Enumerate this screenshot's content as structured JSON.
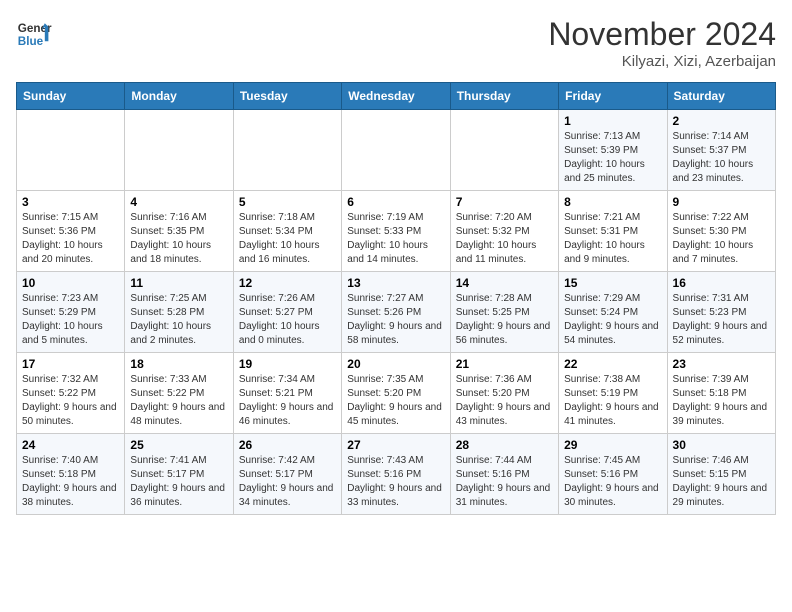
{
  "header": {
    "logo_line1": "General",
    "logo_line2": "Blue",
    "month_title": "November 2024",
    "subtitle": "Kilyazi, Xizi, Azerbaijan"
  },
  "weekdays": [
    "Sunday",
    "Monday",
    "Tuesday",
    "Wednesday",
    "Thursday",
    "Friday",
    "Saturday"
  ],
  "weeks": [
    [
      {
        "day": "",
        "info": ""
      },
      {
        "day": "",
        "info": ""
      },
      {
        "day": "",
        "info": ""
      },
      {
        "day": "",
        "info": ""
      },
      {
        "day": "",
        "info": ""
      },
      {
        "day": "1",
        "info": "Sunrise: 7:13 AM\nSunset: 5:39 PM\nDaylight: 10 hours and 25 minutes."
      },
      {
        "day": "2",
        "info": "Sunrise: 7:14 AM\nSunset: 5:37 PM\nDaylight: 10 hours and 23 minutes."
      }
    ],
    [
      {
        "day": "3",
        "info": "Sunrise: 7:15 AM\nSunset: 5:36 PM\nDaylight: 10 hours and 20 minutes."
      },
      {
        "day": "4",
        "info": "Sunrise: 7:16 AM\nSunset: 5:35 PM\nDaylight: 10 hours and 18 minutes."
      },
      {
        "day": "5",
        "info": "Sunrise: 7:18 AM\nSunset: 5:34 PM\nDaylight: 10 hours and 16 minutes."
      },
      {
        "day": "6",
        "info": "Sunrise: 7:19 AM\nSunset: 5:33 PM\nDaylight: 10 hours and 14 minutes."
      },
      {
        "day": "7",
        "info": "Sunrise: 7:20 AM\nSunset: 5:32 PM\nDaylight: 10 hours and 11 minutes."
      },
      {
        "day": "8",
        "info": "Sunrise: 7:21 AM\nSunset: 5:31 PM\nDaylight: 10 hours and 9 minutes."
      },
      {
        "day": "9",
        "info": "Sunrise: 7:22 AM\nSunset: 5:30 PM\nDaylight: 10 hours and 7 minutes."
      }
    ],
    [
      {
        "day": "10",
        "info": "Sunrise: 7:23 AM\nSunset: 5:29 PM\nDaylight: 10 hours and 5 minutes."
      },
      {
        "day": "11",
        "info": "Sunrise: 7:25 AM\nSunset: 5:28 PM\nDaylight: 10 hours and 2 minutes."
      },
      {
        "day": "12",
        "info": "Sunrise: 7:26 AM\nSunset: 5:27 PM\nDaylight: 10 hours and 0 minutes."
      },
      {
        "day": "13",
        "info": "Sunrise: 7:27 AM\nSunset: 5:26 PM\nDaylight: 9 hours and 58 minutes."
      },
      {
        "day": "14",
        "info": "Sunrise: 7:28 AM\nSunset: 5:25 PM\nDaylight: 9 hours and 56 minutes."
      },
      {
        "day": "15",
        "info": "Sunrise: 7:29 AM\nSunset: 5:24 PM\nDaylight: 9 hours and 54 minutes."
      },
      {
        "day": "16",
        "info": "Sunrise: 7:31 AM\nSunset: 5:23 PM\nDaylight: 9 hours and 52 minutes."
      }
    ],
    [
      {
        "day": "17",
        "info": "Sunrise: 7:32 AM\nSunset: 5:22 PM\nDaylight: 9 hours and 50 minutes."
      },
      {
        "day": "18",
        "info": "Sunrise: 7:33 AM\nSunset: 5:22 PM\nDaylight: 9 hours and 48 minutes."
      },
      {
        "day": "19",
        "info": "Sunrise: 7:34 AM\nSunset: 5:21 PM\nDaylight: 9 hours and 46 minutes."
      },
      {
        "day": "20",
        "info": "Sunrise: 7:35 AM\nSunset: 5:20 PM\nDaylight: 9 hours and 45 minutes."
      },
      {
        "day": "21",
        "info": "Sunrise: 7:36 AM\nSunset: 5:20 PM\nDaylight: 9 hours and 43 minutes."
      },
      {
        "day": "22",
        "info": "Sunrise: 7:38 AM\nSunset: 5:19 PM\nDaylight: 9 hours and 41 minutes."
      },
      {
        "day": "23",
        "info": "Sunrise: 7:39 AM\nSunset: 5:18 PM\nDaylight: 9 hours and 39 minutes."
      }
    ],
    [
      {
        "day": "24",
        "info": "Sunrise: 7:40 AM\nSunset: 5:18 PM\nDaylight: 9 hours and 38 minutes."
      },
      {
        "day": "25",
        "info": "Sunrise: 7:41 AM\nSunset: 5:17 PM\nDaylight: 9 hours and 36 minutes."
      },
      {
        "day": "26",
        "info": "Sunrise: 7:42 AM\nSunset: 5:17 PM\nDaylight: 9 hours and 34 minutes."
      },
      {
        "day": "27",
        "info": "Sunrise: 7:43 AM\nSunset: 5:16 PM\nDaylight: 9 hours and 33 minutes."
      },
      {
        "day": "28",
        "info": "Sunrise: 7:44 AM\nSunset: 5:16 PM\nDaylight: 9 hours and 31 minutes."
      },
      {
        "day": "29",
        "info": "Sunrise: 7:45 AM\nSunset: 5:16 PM\nDaylight: 9 hours and 30 minutes."
      },
      {
        "day": "30",
        "info": "Sunrise: 7:46 AM\nSunset: 5:15 PM\nDaylight: 9 hours and 29 minutes."
      }
    ]
  ]
}
